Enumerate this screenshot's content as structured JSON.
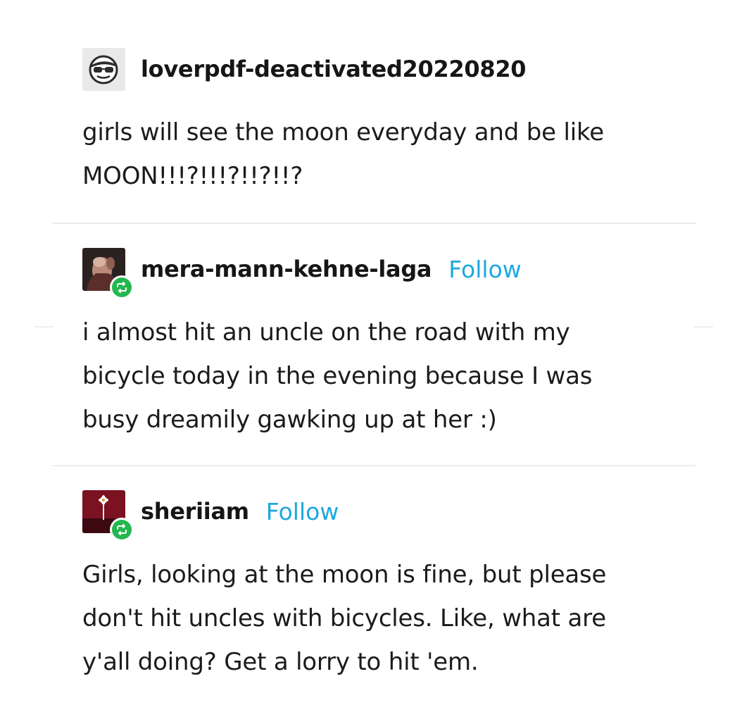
{
  "thread": [
    {
      "username": "loverpdf-deactivated20220820",
      "follow_label": "",
      "avatar_icon": "sunglasses-face-icon",
      "reblog_icon": "",
      "body_lines": [
        "girls will see the moon everyday and be like",
        "MOON!!!?!!!?!!?!!?"
      ]
    },
    {
      "username": "mera-mann-kehne-laga",
      "follow_label": "Follow",
      "avatar_icon": "user-photo-avatar",
      "reblog_icon": "reblog-icon",
      "body_lines": [
        "i almost hit an uncle on the road with my",
        "bicycle today in the evening because I was",
        "busy dreamily gawking up at her  :)"
      ]
    },
    {
      "username": "sheriiam",
      "follow_label": "Follow",
      "avatar_icon": "flower-avatar",
      "reblog_icon": "reblog-icon",
      "body_lines": [
        "Girls, looking at the moon is fine, but please",
        "don't hit uncles with bicycles. Like, what are",
        "y'all doing? Get a lorry to hit 'em."
      ]
    }
  ],
  "colors": {
    "follow": "#1ea7e0",
    "reblog_badge": "#22b74f",
    "divider": "#ebebeb",
    "text": "#1b1b1b"
  }
}
